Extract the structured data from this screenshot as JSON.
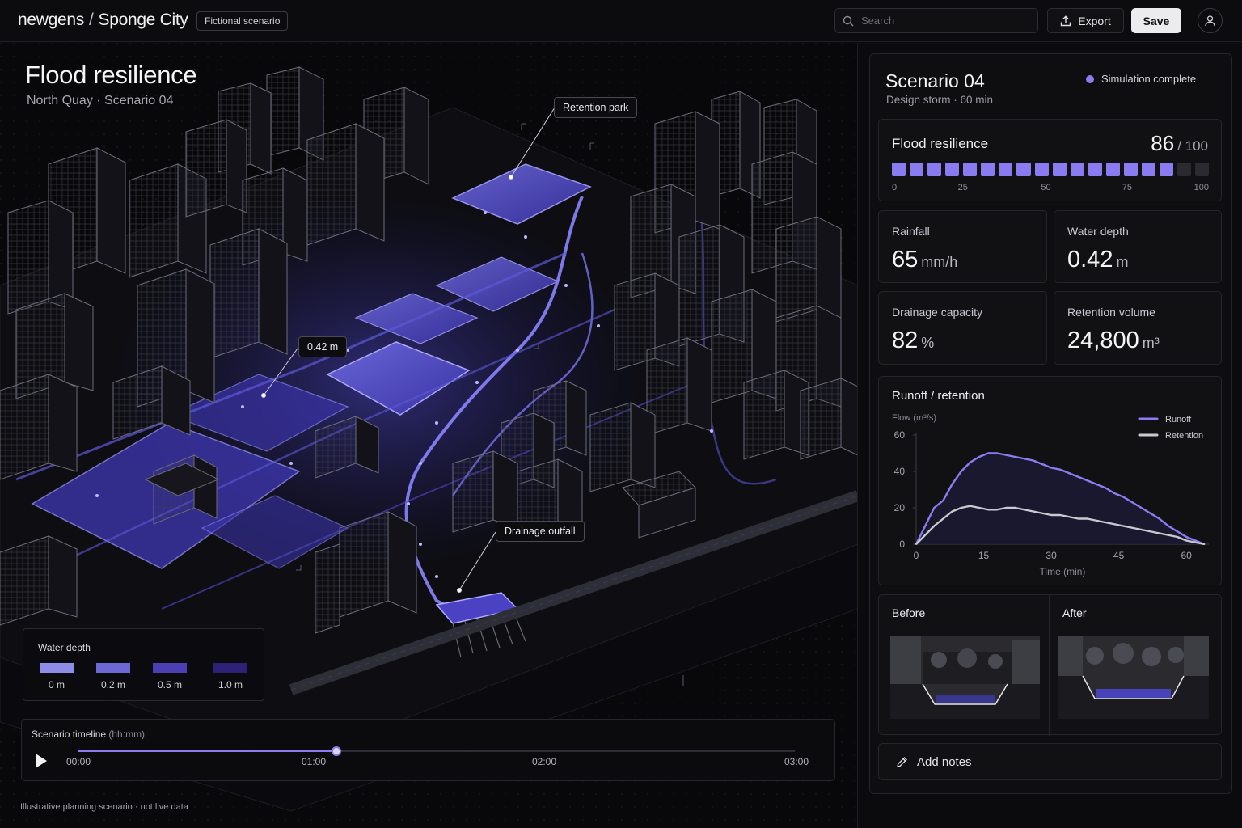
{
  "header": {
    "brand": "newgens",
    "separator": "/",
    "project": "Sponge City",
    "badge": "Fictional scenario",
    "search_placeholder": "Search",
    "export_label": "Export",
    "save_label": "Save"
  },
  "map": {
    "title": "Flood resilience",
    "subtitle": "North Quay · Scenario 04",
    "callouts": {
      "retention_park": "Retention park",
      "depth": "0.42 m",
      "drainage_outfall": "Drainage outfall"
    }
  },
  "legend": {
    "title": "Water depth",
    "items": [
      {
        "label": "0 m",
        "color": "#8d8ce6"
      },
      {
        "label": "0.2 m",
        "color": "#6c69d4"
      },
      {
        "label": "0.5 m",
        "color": "#4b3fb3"
      },
      {
        "label": "1.0 m",
        "color": "#2e2278"
      }
    ]
  },
  "timeline": {
    "title": "Scenario timeline",
    "unit": "(hh:mm)",
    "progress": 0.36,
    "ticks": [
      "00:00",
      "01:00",
      "02:00",
      "03:00"
    ],
    "footnote": "Illustrative planning scenario · not live data"
  },
  "panel": {
    "title": "Scenario 04",
    "subtitle": "Design storm · 60 min",
    "status": "Simulation complete",
    "score": {
      "label": "Flood resilience",
      "value": "86",
      "max": "/ 100",
      "segments_total": 18,
      "segments_filled": 16,
      "scale": [
        "0",
        "25",
        "50",
        "75",
        "100"
      ]
    },
    "metrics": [
      {
        "label": "Rainfall",
        "value": "65",
        "unit": "mm/h"
      },
      {
        "label": "Water depth",
        "value": "0.42",
        "unit": "m"
      },
      {
        "label": "Drainage capacity",
        "value": "82",
        "unit": "%"
      },
      {
        "label": "Retention volume",
        "value": "24,800",
        "unit": "m³"
      }
    ],
    "before_label": "Before",
    "after_label": "After",
    "notes_label": "Add notes"
  },
  "chart_data": {
    "type": "line",
    "title": "Runoff / retention",
    "ylabel": "Flow (m³/s)",
    "xlabel": "Time (min)",
    "xlim": [
      0,
      65
    ],
    "ylim": [
      0,
      60
    ],
    "xticks": [
      0,
      15,
      30,
      45,
      60
    ],
    "yticks": [
      0,
      20,
      40,
      60
    ],
    "legend_position": "top-right",
    "colors": {
      "Runoff": "#8b7cf0",
      "Retention": "#c9c9d0"
    },
    "series": [
      {
        "name": "Runoff",
        "x": [
          0,
          2,
          4,
          6,
          8,
          10,
          12,
          14,
          16,
          18,
          20,
          22,
          24,
          26,
          28,
          30,
          32,
          34,
          36,
          38,
          40,
          42,
          44,
          46,
          48,
          50,
          52,
          54,
          56,
          58,
          60,
          62,
          64
        ],
        "y": [
          0,
          10,
          20,
          24,
          33,
          40,
          45,
          48,
          50,
          50,
          49,
          48,
          47,
          46,
          44,
          42,
          41,
          39,
          37,
          35,
          33,
          31,
          28,
          26,
          23,
          20,
          17,
          14,
          10,
          7,
          4,
          2,
          0
        ]
      },
      {
        "name": "Retention",
        "x": [
          0,
          2,
          4,
          6,
          8,
          10,
          12,
          14,
          16,
          18,
          20,
          22,
          24,
          26,
          28,
          30,
          32,
          34,
          36,
          38,
          40,
          42,
          44,
          46,
          48,
          50,
          52,
          54,
          56,
          58,
          60,
          62,
          64
        ],
        "y": [
          0,
          5,
          10,
          14,
          18,
          20,
          21,
          20,
          19,
          19,
          20,
          20,
          19,
          18,
          17,
          16,
          16,
          15,
          14,
          14,
          13,
          12,
          11,
          10,
          9,
          8,
          7,
          6,
          5,
          4,
          2,
          1,
          0
        ]
      }
    ]
  }
}
